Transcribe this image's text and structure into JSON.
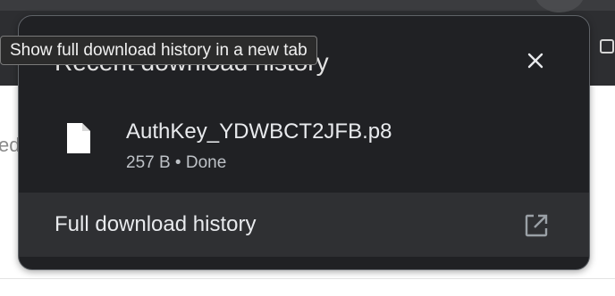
{
  "tooltip": {
    "text": "Show full download history in a new tab"
  },
  "bubble": {
    "title": "Recent download history",
    "close_icon": "close-icon"
  },
  "download": {
    "file_name": "AuthKey_YDWBCT2JFB.p8",
    "status": "257 B • Done",
    "file_icon": "file-icon"
  },
  "footer": {
    "full_history_label": "Full download history",
    "open_icon": "open-in-new-tab-icon"
  },
  "background": {
    "fragment_text": "ed"
  },
  "colors": {
    "bubble_bg": "#202124",
    "footer_bg": "#2f3033",
    "text_primary": "#e8eaed",
    "text_secondary": "#bdc1c6"
  }
}
